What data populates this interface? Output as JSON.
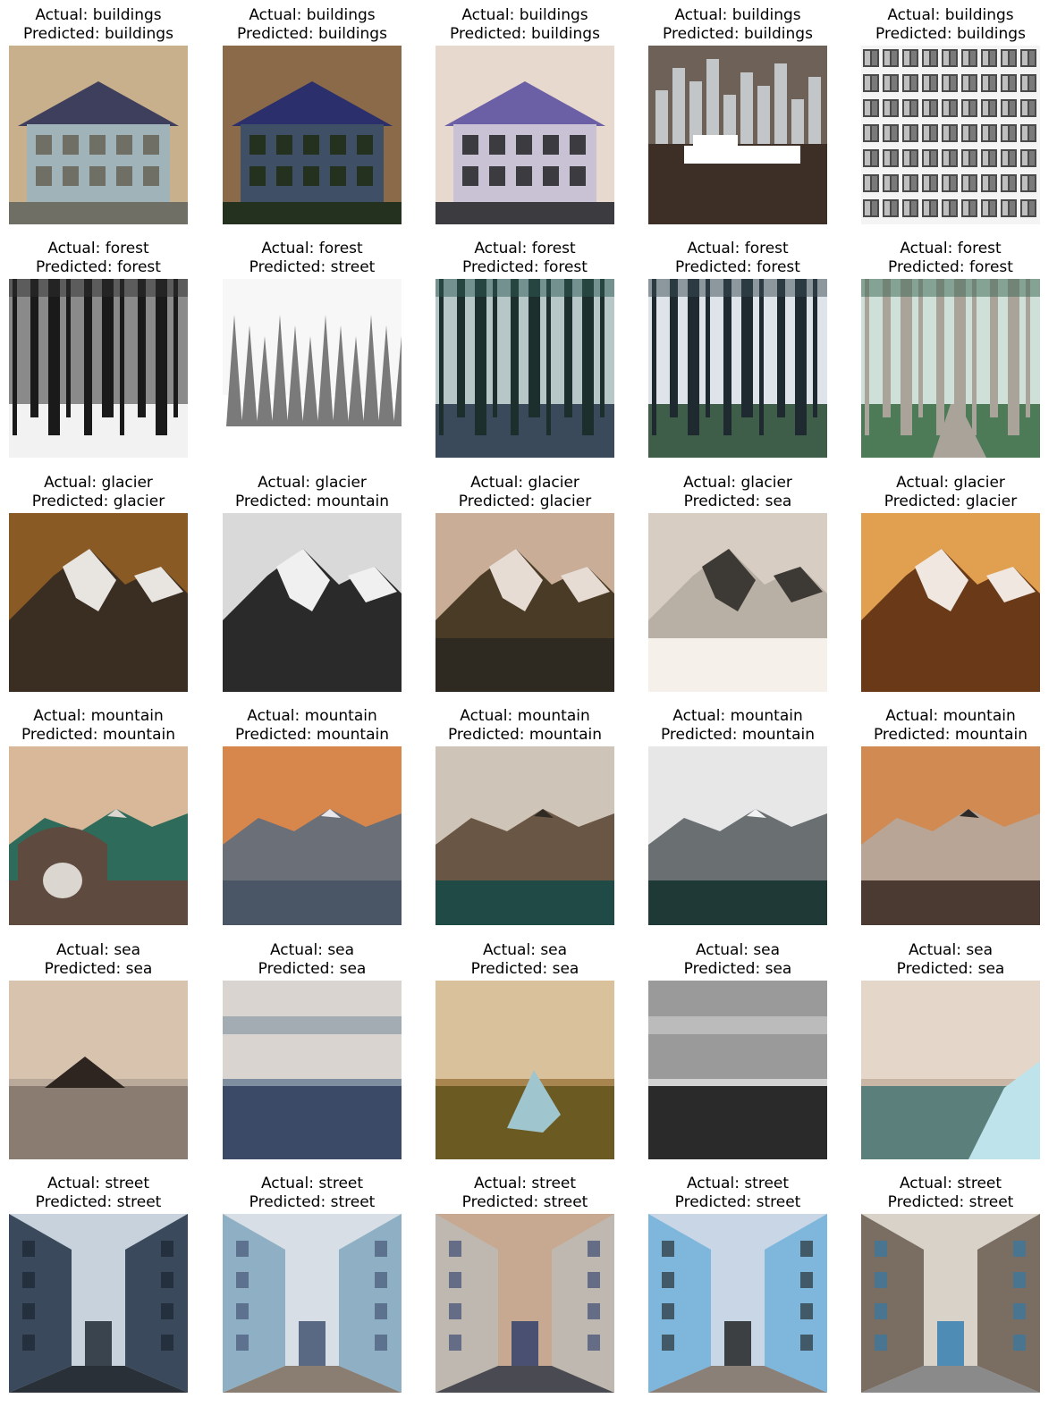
{
  "figure": {
    "actual_prefix": "Actual: ",
    "predicted_prefix": "Predicted: ",
    "rows": [
      {
        "cells": [
          {
            "actual": "buildings",
            "predicted": "buildings",
            "scene": "buildings-facade",
            "palette": {
              "sky": "#c9b08c",
              "mid": "#9fb3b8",
              "ground": "#6f6f66",
              "accent": "#3e3f5c"
            }
          },
          {
            "actual": "buildings",
            "predicted": "buildings",
            "scene": "buildings-house",
            "palette": {
              "sky": "#8a6a48",
              "mid": "#3f4f66",
              "ground": "#25311f",
              "accent": "#2b2f6b"
            }
          },
          {
            "actual": "buildings",
            "predicted": "buildings",
            "scene": "buildings-store",
            "palette": {
              "sky": "#e8d9cf",
              "mid": "#c9c2d4",
              "ground": "#3b3b40",
              "accent": "#6b5fa6"
            }
          },
          {
            "actual": "buildings",
            "predicted": "buildings",
            "scene": "buildings-skyline",
            "palette": {
              "sky": "#6e6258",
              "mid": "#c2c6c8",
              "ground": "#3d2e26",
              "accent": "#ffffff"
            }
          },
          {
            "actual": "buildings",
            "predicted": "buildings",
            "scene": "buildings-windows",
            "palette": {
              "sky": "#f4f4f4",
              "mid": "#bfbfbf",
              "ground": "#4a4a4a",
              "accent": "#7a7a7a"
            }
          }
        ]
      },
      {
        "cells": [
          {
            "actual": "forest",
            "predicted": "forest",
            "scene": "forest-snow-trunks",
            "palette": {
              "sky": "#8a8a8a",
              "mid": "#2e2e2e",
              "ground": "#f2f2f2",
              "accent": "#1a1a1a"
            }
          },
          {
            "actual": "forest",
            "predicted": "street",
            "scene": "forest-snow-pines",
            "palette": {
              "sky": "#f7f7f7",
              "mid": "#7a7a7a",
              "ground": "#ffffff",
              "accent": "#3a3a3a"
            }
          },
          {
            "actual": "forest",
            "predicted": "forest",
            "scene": "forest-teal",
            "palette": {
              "sky": "#b7c6c6",
              "mid": "#2f5c55",
              "ground": "#3a4a5a",
              "accent": "#1d2f2d"
            }
          },
          {
            "actual": "forest",
            "predicted": "forest",
            "scene": "forest-park",
            "palette": {
              "sky": "#dfe4ea",
              "mid": "#3a4a52",
              "ground": "#3f5e4a",
              "accent": "#1f2a30"
            }
          },
          {
            "actual": "forest",
            "predicted": "forest",
            "scene": "forest-path",
            "palette": {
              "sky": "#cfe0d8",
              "mid": "#3a6552",
              "ground": "#4d7a57",
              "accent": "#a9a39a"
            }
          }
        ]
      },
      {
        "cells": [
          {
            "actual": "glacier",
            "predicted": "glacier",
            "scene": "glacier-peak",
            "palette": {
              "sky": "#8a5a24",
              "mid": "#e8e4e0",
              "ground": "#3a2d22",
              "accent": "#5a4432"
            }
          },
          {
            "actual": "glacier",
            "predicted": "mountain",
            "scene": "glacier-gray",
            "palette": {
              "sky": "#d9d9d9",
              "mid": "#f0f0f0",
              "ground": "#2a2a2a",
              "accent": "#5a5a5a"
            }
          },
          {
            "actual": "glacier",
            "predicted": "glacier",
            "scene": "glacier-lake",
            "palette": {
              "sky": "#c9ad97",
              "mid": "#e6dcd4",
              "ground": "#4a3b26",
              "accent": "#2e2a22"
            }
          },
          {
            "actual": "glacier",
            "predicted": "sea",
            "scene": "glacier-valley",
            "palette": {
              "sky": "#d7cdc3",
              "mid": "#3d3934",
              "ground": "#b8afa5",
              "accent": "#f5f0ea"
            }
          },
          {
            "actual": "glacier",
            "predicted": "glacier",
            "scene": "glacier-aerial",
            "palette": {
              "sky": "#e0a050",
              "mid": "#f0e8e0",
              "ground": "#6a3a18",
              "accent": "#1e3a40"
            }
          }
        ]
      },
      {
        "cells": [
          {
            "actual": "mountain",
            "predicted": "mountain",
            "scene": "mountain-chapel",
            "palette": {
              "sky": "#d9b89a",
              "mid": "#2f6b5a",
              "ground": "#5e4a3e",
              "accent": "#dcd6d0"
            }
          },
          {
            "actual": "mountain",
            "predicted": "mountain",
            "scene": "mountain-rocks",
            "palette": {
              "sky": "#d7874c",
              "mid": "#6a6f78",
              "ground": "#4a5566",
              "accent": "#e8e8ea"
            }
          },
          {
            "actual": "mountain",
            "predicted": "mountain",
            "scene": "mountain-hills",
            "palette": {
              "sky": "#cfc4b8",
              "mid": "#6a5644",
              "ground": "#1f4a45",
              "accent": "#2f2a24"
            }
          },
          {
            "actual": "mountain",
            "predicted": "mountain",
            "scene": "mountain-snowy",
            "palette": {
              "sky": "#e7e7e7",
              "mid": "#6a6f72",
              "ground": "#1f3a36",
              "accent": "#f2f2f2"
            }
          },
          {
            "actual": "mountain",
            "predicted": "mountain",
            "scene": "mountain-city",
            "palette": {
              "sky": "#d08a52",
              "mid": "#b9a596",
              "ground": "#4a3a32",
              "accent": "#2e2a28"
            }
          }
        ]
      },
      {
        "cells": [
          {
            "actual": "sea",
            "predicted": "sea",
            "scene": "sea-island",
            "palette": {
              "sky": "#d8c4ae",
              "mid": "#b9a99a",
              "ground": "#8a7c70",
              "accent": "#2e2520"
            }
          },
          {
            "actual": "sea",
            "predicted": "sea",
            "scene": "sea-beach",
            "palette": {
              "sky": "#d9d4cf",
              "mid": "#7f8fa0",
              "ground": "#3b4a66",
              "accent": "#1e2430"
            }
          },
          {
            "actual": "sea",
            "predicted": "sea",
            "scene": "sea-rock",
            "palette": {
              "sky": "#d9c19c",
              "mid": "#a8854e",
              "ground": "#6b5a22",
              "accent": "#9fc6cf"
            }
          },
          {
            "actual": "sea",
            "predicted": "sea",
            "scene": "sea-clouds",
            "palette": {
              "sky": "#9a9a9a",
              "mid": "#d2d2d2",
              "ground": "#2a2a2a",
              "accent": "#4a4a4a"
            }
          },
          {
            "actual": "sea",
            "predicted": "sea",
            "scene": "sea-coast",
            "palette": {
              "sky": "#e4d6c8",
              "mid": "#c9b6a4",
              "ground": "#5b7f7a",
              "accent": "#bfe3ea"
            }
          }
        ]
      },
      {
        "cells": [
          {
            "actual": "street",
            "predicted": "street",
            "scene": "street-alley",
            "palette": {
              "sky": "#c8d2dc",
              "mid": "#3a4a5c",
              "ground": "#2a3038",
              "accent": "#16202a"
            }
          },
          {
            "actual": "street",
            "predicted": "street",
            "scene": "street-lane",
            "palette": {
              "sky": "#d7dee6",
              "mid": "#8fb0c4",
              "ground": "#8a7e72",
              "accent": "#3a4a6a"
            }
          },
          {
            "actual": "street",
            "predicted": "street",
            "scene": "street-dome",
            "palette": {
              "sky": "#c7a890",
              "mid": "#bfb8b0",
              "ground": "#4a4a52",
              "accent": "#2a3a6a"
            }
          },
          {
            "actual": "street",
            "predicted": "street",
            "scene": "street-wall",
            "palette": {
              "sky": "#c9d6e6",
              "mid": "#7eb6dc",
              "ground": "#8a8078",
              "accent": "#1a1a1a"
            }
          },
          {
            "actual": "street",
            "predicted": "street",
            "scene": "street-junction",
            "palette": {
              "sky": "#d9d2c8",
              "mid": "#7a6e62",
              "ground": "#8a8a8a",
              "accent": "#2a7ab0"
            }
          }
        ]
      }
    ]
  }
}
